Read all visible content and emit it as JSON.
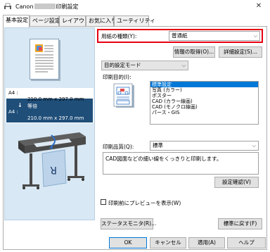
{
  "window": {
    "title_prefix": "Canon",
    "title_suffix": "印刷設定",
    "close_symbol": "✕"
  },
  "tabs": [
    {
      "label": "基本設定"
    },
    {
      "label": "ページ設定"
    },
    {
      "label": "レイアウト"
    },
    {
      "label": "お気に入り"
    },
    {
      "label": "ユーティリティ"
    }
  ],
  "media": {
    "label": "用紙の種類(Y):",
    "value": "普通紙",
    "highlight_color": "#e60012"
  },
  "buttons": {
    "get_info": "情報の取得(O)...",
    "detailed_settings": "詳細設定(S)...",
    "confirm_settings": "設定確認(V)",
    "status_monitor": "ステータスモニタ(R)...",
    "restore_defaults": "標準に戻す(F)",
    "ok": "OK",
    "cancel": "キャンセル",
    "apply": "適用(A)",
    "help": "ヘルプ"
  },
  "purpose_mode": {
    "value": "目的設定モード"
  },
  "print_purpose": {
    "label": "印刷目的(I):",
    "items": [
      "標準設定",
      "写真 (カラー)",
      "ポスター",
      "CAD (カラー線画)",
      "CAD (モノクロ線画)",
      "パース・GIS"
    ],
    "selected_index": 0
  },
  "quality": {
    "label": "印刷品質(Q):",
    "value": "標準",
    "description": "CAD図面などの細い線をくっきりと印刷します。"
  },
  "preview": {
    "size_in_label": "A4 :",
    "size_in_dims": "210.0 mm x 297.0 mm",
    "arrow": "↓",
    "scale": "等倍",
    "size_out_label": "A4 :",
    "size_out_dims": "210.0 mm x 297.0 mm",
    "paper_letter": "R"
  },
  "preview_before_print": {
    "label": "印刷前にプレビューを表示(W)",
    "checked": false
  },
  "colors": {
    "accent": "#0078d7",
    "preview_bg": "#d8e8f4",
    "size_box": "#1f4e79"
  }
}
